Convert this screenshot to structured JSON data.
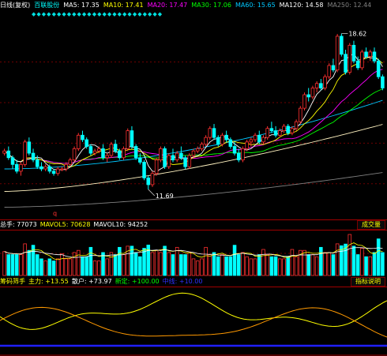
{
  "legend": {
    "period": "日线(复权)",
    "stock": "百联股份",
    "ma": [
      {
        "label": "MA5: 17.35",
        "color": "#ffffff"
      },
      {
        "label": "MA10: 17.41",
        "color": "#ffff00"
      },
      {
        "label": "MA20: 17.47",
        "color": "#ff00ff"
      },
      {
        "label": "MA30: 17.06",
        "color": "#00ff00"
      },
      {
        "label": "MA60: 15.65",
        "color": "#00c8ff"
      },
      {
        "label": "MA120: 14.58",
        "color": "#ffffff"
      },
      {
        "label": "MA250: 12.44",
        "color": "#808080"
      }
    ]
  },
  "price_chart": {
    "high_label": "18.62",
    "low_label": "11.69",
    "marker": "q",
    "colors": {
      "up": "#ff3030",
      "down": "#00ffff",
      "grid": "#6e0000"
    }
  },
  "volume_panel": {
    "total_label": "总手: 77073",
    "mavol5_label": "MAVOL5: 70628",
    "mavol10_label": "MAVOL10: 94252",
    "tab_label": "成交量"
  },
  "indicator_panel": {
    "name": "筹码筛手",
    "main_label": "主力: +13.55",
    "retail_label": "散户: +73.97",
    "fixed_label": "新定: +100.00",
    "extra_label": "中线: +10.00",
    "tab_label": "指标说明"
  },
  "chart_data": {
    "type": "candlestick",
    "title": "百联股份",
    "ma_values": {
      "MA5": 17.35,
      "MA10": 17.41,
      "MA20": 17.47,
      "MA30": 17.06,
      "MA60": 15.65,
      "MA120": 14.58,
      "MA250": 12.44
    },
    "price_range": [
      10.6,
      19.2
    ],
    "annotated_high": 18.62,
    "annotated_low": 11.69,
    "candles": [
      [
        13.3,
        13.5,
        13.2,
        13.4
      ],
      [
        13.4,
        13.6,
        13.0,
        13.1
      ],
      [
        13.1,
        13.2,
        12.6,
        12.8
      ],
      [
        12.8,
        13.0,
        12.4,
        12.5
      ],
      [
        12.5,
        12.9,
        12.3,
        12.8
      ],
      [
        12.8,
        13.9,
        12.7,
        13.8
      ],
      [
        13.8,
        14.0,
        13.2,
        13.3
      ],
      [
        13.3,
        13.5,
        12.9,
        13.0
      ],
      [
        13.0,
        13.2,
        12.6,
        12.7
      ],
      [
        12.7,
        12.9,
        12.5,
        12.6
      ],
      [
        12.6,
        12.8,
        12.5,
        12.7
      ],
      [
        12.7,
        12.8,
        12.4,
        12.5
      ],
      [
        12.5,
        12.6,
        12.3,
        12.4
      ],
      [
        12.4,
        12.7,
        12.3,
        12.6
      ],
      [
        12.6,
        12.7,
        12.5,
        12.6
      ],
      [
        12.6,
        12.9,
        12.5,
        12.8
      ],
      [
        12.8,
        13.1,
        12.7,
        13.0
      ],
      [
        13.0,
        13.6,
        12.9,
        13.5
      ],
      [
        13.5,
        14.2,
        13.4,
        14.1
      ],
      [
        14.1,
        14.3,
        13.8,
        13.9
      ],
      [
        13.9,
        14.0,
        13.5,
        13.6
      ],
      [
        13.6,
        13.7,
        13.2,
        13.3
      ],
      [
        13.3,
        13.5,
        13.2,
        13.4
      ],
      [
        13.4,
        13.6,
        13.3,
        13.5
      ],
      [
        13.5,
        13.7,
        13.0,
        13.1
      ],
      [
        13.1,
        13.3,
        12.9,
        13.2
      ],
      [
        13.2,
        13.8,
        13.1,
        13.7
      ],
      [
        13.7,
        13.9,
        13.3,
        13.4
      ],
      [
        13.4,
        13.5,
        13.0,
        13.1
      ],
      [
        13.1,
        13.6,
        13.0,
        13.5
      ],
      [
        13.5,
        14.4,
        13.4,
        14.3
      ],
      [
        14.3,
        14.5,
        13.5,
        13.6
      ],
      [
        13.6,
        13.7,
        13.0,
        13.1
      ],
      [
        13.1,
        13.3,
        12.8,
        12.9
      ],
      [
        12.9,
        13.0,
        12.1,
        12.2
      ],
      [
        12.2,
        12.3,
        11.69,
        11.9
      ],
      [
        11.9,
        12.5,
        11.8,
        12.4
      ],
      [
        12.4,
        13.1,
        12.3,
        13.0
      ],
      [
        13.0,
        13.6,
        12.9,
        13.5
      ],
      [
        13.5,
        13.6,
        12.6,
        12.7
      ],
      [
        12.7,
        13.3,
        12.6,
        13.2
      ],
      [
        13.2,
        13.5,
        12.9,
        13.0
      ],
      [
        13.0,
        13.4,
        12.9,
        13.3
      ],
      [
        13.3,
        13.6,
        13.0,
        13.1
      ],
      [
        13.1,
        13.2,
        12.6,
        12.7
      ],
      [
        12.7,
        13.3,
        12.6,
        13.2
      ],
      [
        13.2,
        13.5,
        13.1,
        13.4
      ],
      [
        13.4,
        13.6,
        13.3,
        13.5
      ],
      [
        13.5,
        13.8,
        13.4,
        13.7
      ],
      [
        13.7,
        14.1,
        13.6,
        14.0
      ],
      [
        14.0,
        14.5,
        13.9,
        14.4
      ],
      [
        14.4,
        14.6,
        13.9,
        14.0
      ],
      [
        14.0,
        14.1,
        13.6,
        13.7
      ],
      [
        13.7,
        14.2,
        13.6,
        14.1
      ],
      [
        14.1,
        14.3,
        13.8,
        13.9
      ],
      [
        13.9,
        14.0,
        13.5,
        13.6
      ],
      [
        13.6,
        13.8,
        13.2,
        13.3
      ],
      [
        13.3,
        13.5,
        12.9,
        13.0
      ],
      [
        13.0,
        13.6,
        12.9,
        13.5
      ],
      [
        13.5,
        13.9,
        13.4,
        13.8
      ],
      [
        13.8,
        14.0,
        13.6,
        13.9
      ],
      [
        13.9,
        14.2,
        13.8,
        14.1
      ],
      [
        14.1,
        14.3,
        13.7,
        13.8
      ],
      [
        13.8,
        14.1,
        13.7,
        14.0
      ],
      [
        14.0,
        14.5,
        13.9,
        14.4
      ],
      [
        14.4,
        14.7,
        14.2,
        14.3
      ],
      [
        14.3,
        14.5,
        14.0,
        14.1
      ],
      [
        14.1,
        14.4,
        14.0,
        14.3
      ],
      [
        14.3,
        14.6,
        14.2,
        14.5
      ],
      [
        14.5,
        14.6,
        14.1,
        14.2
      ],
      [
        14.2,
        14.5,
        14.1,
        14.4
      ],
      [
        14.4,
        14.8,
        14.3,
        14.7
      ],
      [
        14.7,
        15.4,
        14.6,
        15.3
      ],
      [
        15.3,
        16.0,
        15.2,
        15.9
      ],
      [
        15.9,
        16.2,
        15.6,
        15.8
      ],
      [
        15.8,
        16.3,
        15.7,
        16.2
      ],
      [
        16.2,
        16.5,
        16.0,
        16.4
      ],
      [
        16.4,
        16.6,
        16.1,
        16.2
      ],
      [
        16.2,
        16.8,
        16.1,
        16.7
      ],
      [
        16.7,
        17.3,
        16.6,
        17.2
      ],
      [
        17.2,
        17.5,
        16.9,
        17.0
      ],
      [
        17.0,
        18.6,
        16.9,
        18.5
      ],
      [
        18.5,
        18.62,
        17.6,
        17.7
      ],
      [
        17.7,
        17.9,
        16.8,
        16.9
      ],
      [
        16.9,
        18.2,
        16.8,
        18.1
      ],
      [
        18.1,
        18.3,
        17.3,
        17.4
      ],
      [
        17.4,
        17.6,
        17.0,
        17.1
      ],
      [
        17.1,
        17.9,
        17.0,
        17.8
      ],
      [
        17.8,
        18.0,
        17.5,
        17.6
      ],
      [
        17.6,
        17.9,
        17.4,
        17.8
      ],
      [
        17.8,
        18.0,
        17.3,
        17.4
      ],
      [
        17.4,
        17.5,
        16.6,
        16.7
      ],
      [
        16.7,
        16.8,
        16.1,
        16.2
      ]
    ]
  }
}
